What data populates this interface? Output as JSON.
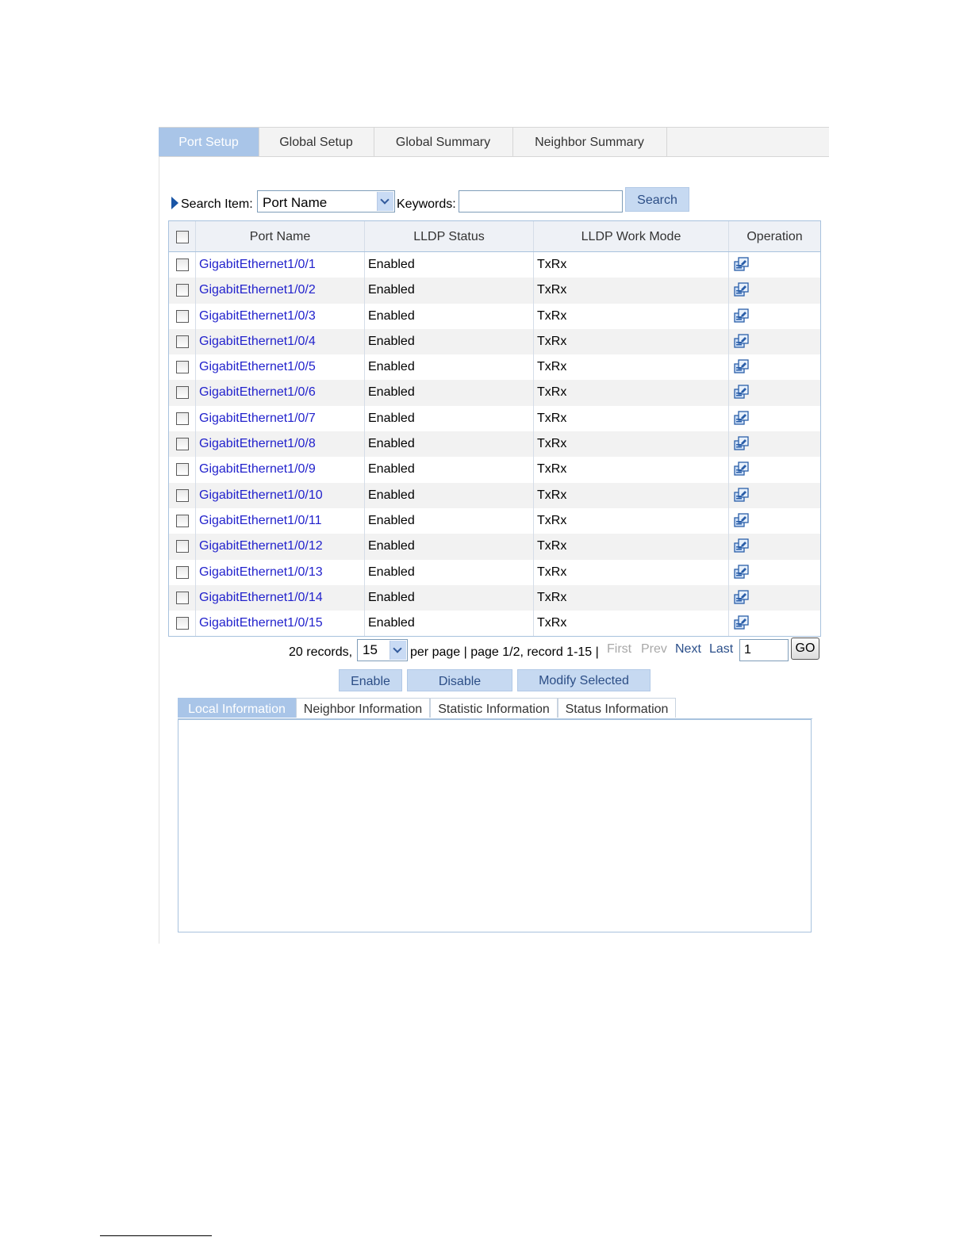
{
  "top_tabs": [
    "Port Setup",
    "Global Setup",
    "Global Summary",
    "Neighbor Summary"
  ],
  "search": {
    "label": "Search Item:",
    "selected": "Port Name",
    "keywords_label": "Keywords:",
    "keywords_value": "",
    "button": "Search"
  },
  "table": {
    "headers": [
      "Port Name",
      "LLDP Status",
      "LLDP Work Mode",
      "Operation"
    ],
    "rows": [
      {
        "port": "GigabitEthernet1/0/1",
        "status": "Enabled",
        "mode": "TxRx"
      },
      {
        "port": "GigabitEthernet1/0/2",
        "status": "Enabled",
        "mode": "TxRx"
      },
      {
        "port": "GigabitEthernet1/0/3",
        "status": "Enabled",
        "mode": "TxRx"
      },
      {
        "port": "GigabitEthernet1/0/4",
        "status": "Enabled",
        "mode": "TxRx"
      },
      {
        "port": "GigabitEthernet1/0/5",
        "status": "Enabled",
        "mode": "TxRx"
      },
      {
        "port": "GigabitEthernet1/0/6",
        "status": "Enabled",
        "mode": "TxRx"
      },
      {
        "port": "GigabitEthernet1/0/7",
        "status": "Enabled",
        "mode": "TxRx"
      },
      {
        "port": "GigabitEthernet1/0/8",
        "status": "Enabled",
        "mode": "TxRx"
      },
      {
        "port": "GigabitEthernet1/0/9",
        "status": "Enabled",
        "mode": "TxRx"
      },
      {
        "port": "GigabitEthernet1/0/10",
        "status": "Enabled",
        "mode": "TxRx"
      },
      {
        "port": "GigabitEthernet1/0/11",
        "status": "Enabled",
        "mode": "TxRx"
      },
      {
        "port": "GigabitEthernet1/0/12",
        "status": "Enabled",
        "mode": "TxRx"
      },
      {
        "port": "GigabitEthernet1/0/13",
        "status": "Enabled",
        "mode": "TxRx"
      },
      {
        "port": "GigabitEthernet1/0/14",
        "status": "Enabled",
        "mode": "TxRx"
      },
      {
        "port": "GigabitEthernet1/0/15",
        "status": "Enabled",
        "mode": "TxRx"
      }
    ]
  },
  "pagination": {
    "records": "20 records,",
    "per_page_value": "15",
    "summary": "per page | page 1/2, record 1-15 |",
    "first": "First",
    "prev": "Prev",
    "next": "Next",
    "last": "Last",
    "page_input": "1",
    "go": "GO"
  },
  "actions": {
    "enable": "Enable",
    "disable": "Disable",
    "modify": "Modify Selected"
  },
  "info_tabs": [
    "Local Information",
    "Neighbor Information",
    "Statistic Information",
    "Status Information"
  ],
  "icons": {
    "operation": "edit-config-icon",
    "search_marker": "triangle-right-icon"
  },
  "colors": {
    "accent": "#a9c5e8",
    "link": "#2222cc",
    "button": "#c6d9f1"
  }
}
